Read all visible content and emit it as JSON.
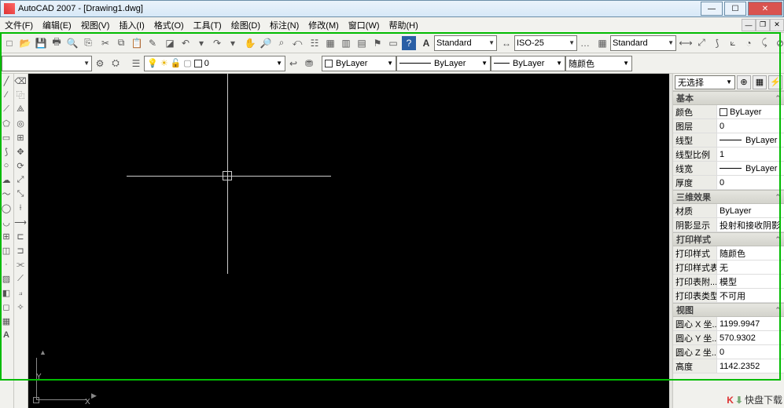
{
  "window": {
    "title": "AutoCAD 2007 - [Drawing1.dwg]"
  },
  "menus": {
    "file": "文件(F)",
    "edit": "编辑(E)",
    "view": "视图(V)",
    "insert": "插入(I)",
    "format": "格式(O)",
    "tools": "工具(T)",
    "draw": "绘图(D)",
    "dim": "标注(N)",
    "modify": "修改(M)",
    "window": "窗口(W)",
    "help": "帮助(H)"
  },
  "toolbar1": {
    "textstyle_icon": "A",
    "textstyle": "Standard",
    "dimstyle_icon": "↔",
    "dimstyle": "ISO-25",
    "tablestyle_icon": "▦",
    "tablestyle": "Standard"
  },
  "toolbar2": {
    "layer_combo": "0",
    "color": "ByLayer",
    "linetype": "ByLayer",
    "lineweight": "ByLayer",
    "plotstyle": "随颜色"
  },
  "props": {
    "selector": "无选择",
    "cat_basic": "基本",
    "basic": {
      "color_k": "颜色",
      "color_v": "ByLayer",
      "layer_k": "图层",
      "layer_v": "0",
      "ltype_k": "线型",
      "ltype_v": "ByLayer",
      "ltscale_k": "线型比例",
      "ltscale_v": "1",
      "lweight_k": "线宽",
      "lweight_v": "ByLayer",
      "thick_k": "厚度",
      "thick_v": "0"
    },
    "cat_3d": "三维效果",
    "threeD": {
      "mat_k": "材质",
      "mat_v": "ByLayer",
      "shadow_k": "阴影显示",
      "shadow_v": "投射和接收阴影"
    },
    "cat_plot": "打印样式",
    "plot": {
      "pstyle_k": "打印样式",
      "pstyle_v": "随颜色",
      "ptable_k": "打印样式表",
      "ptable_v": "无",
      "pattach_k": "打印表附...",
      "pattach_v": "模型",
      "ptype_k": "打印表类型",
      "ptype_v": "不可用"
    },
    "cat_view": "视图",
    "view": {
      "cx_k": "圆心 X 坐...",
      "cx_v": "1199.9947",
      "cy_k": "圆心 Y 坐...",
      "cy_v": "570.9302",
      "cz_k": "圆心 Z 坐...",
      "cz_v": "0",
      "h_k": "高度",
      "h_v": "1142.2352"
    }
  },
  "ucs": {
    "y": "Y",
    "x": "X"
  },
  "watermark": "快盘下载"
}
